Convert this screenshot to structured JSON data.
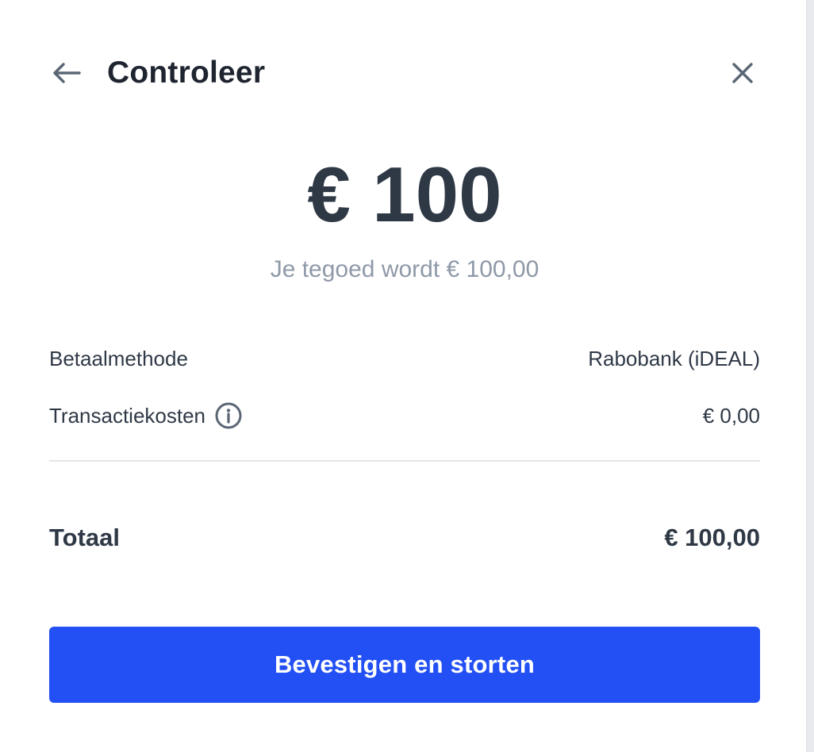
{
  "header": {
    "title": "Controleer",
    "back_icon": "arrow-left-icon",
    "close_icon": "close-icon"
  },
  "summary": {
    "amount": "€ 100",
    "balance_text": "Je tegoed wordt € 100,00"
  },
  "details": {
    "payment_method_label": "Betaalmethode",
    "payment_method_value": "Rabobank (iDEAL)",
    "fee_label": "Transactiekosten",
    "fee_value": "€ 0,00",
    "fee_info_icon": "info-icon"
  },
  "total": {
    "label": "Totaal",
    "value": "€ 100,00"
  },
  "actions": {
    "confirm_label": "Bevestigen en storten"
  },
  "colors": {
    "primary": "#2350f4",
    "text": "#2f3946",
    "muted": "#8f99a8",
    "icon": "#5b6675"
  }
}
